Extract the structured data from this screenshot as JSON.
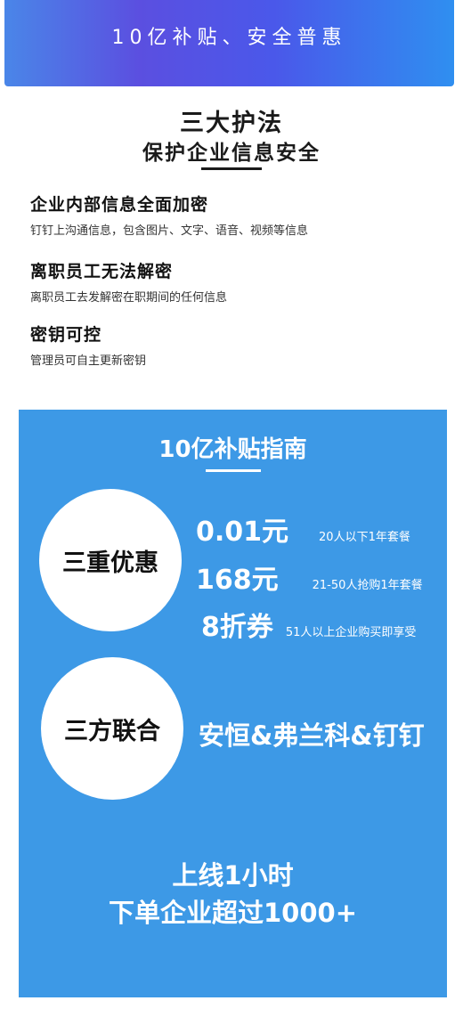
{
  "banner": {
    "text": "10亿补贴、安全普惠"
  },
  "section": {
    "title_line1": "三大护法",
    "title_line2": "保护企业信息安全"
  },
  "features": [
    {
      "title": "企业内部信息全面加密",
      "desc": "钉钉上沟通信息，包含图片、文字、语音、视频等信息"
    },
    {
      "title": "离职员工无法解密",
      "desc": "离职员工去发解密在职期间的任何信息"
    },
    {
      "title": "密钥可控",
      "desc": "管理员可自主更新密钥"
    }
  ],
  "guide": {
    "title": "10亿补贴指南",
    "circle1": "三重优惠",
    "offers": [
      {
        "price": "0.01元",
        "desc": "20人以下1年套餐"
      },
      {
        "price": "168元",
        "desc": "21-50人抢购1年套餐"
      },
      {
        "price": "8折券",
        "desc": "51人以上企业购买即享受"
      }
    ],
    "circle2": "三方联合",
    "partners": "安恒&弗兰科&钉钉",
    "result_line1": "上线1小时",
    "result_line2": "下单企业超过1000+"
  },
  "colors": {
    "panel_blue": "#3d99e6",
    "banner_gradient_start": "#4a86e8",
    "banner_gradient_end": "#2f8ff0"
  }
}
